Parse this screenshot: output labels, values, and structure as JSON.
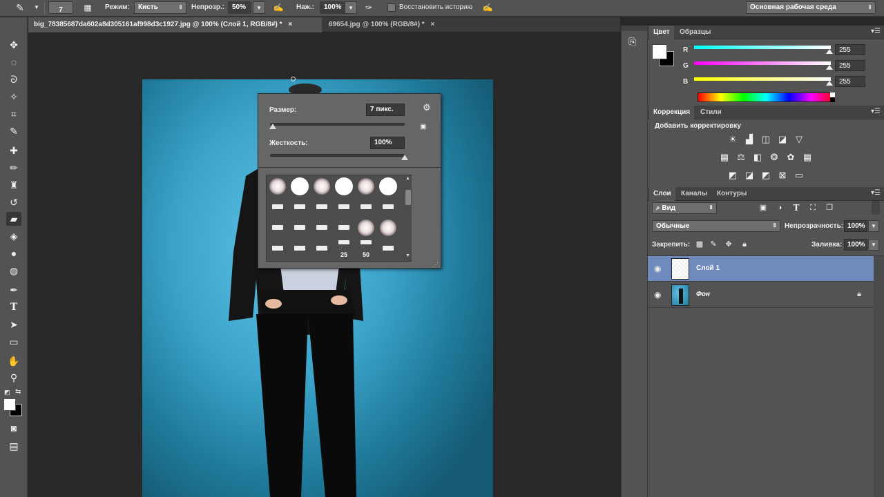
{
  "options_bar": {
    "brush_size": "7",
    "mode_label": "Режим:",
    "mode_value": "Кисть",
    "opacity_label": "Непрозр.:",
    "opacity_value": "50%",
    "pressure_label": "Наж.:",
    "pressure_value": "100%",
    "restore_history_label": "Восстановить историю",
    "workspace_value": "Основная рабочая среда"
  },
  "tabs": [
    {
      "label": "big_78385687da602a8d305161af998d3c1927.jpg @ 100% (Слой 1, RGB/8#) *",
      "close": "×"
    },
    {
      "label": "69654.jpg @ 100% (RGB/8#) *",
      "close": "×"
    }
  ],
  "brush_popup": {
    "size_label": "Размер:",
    "size_value": "7 пикс.",
    "size_fraction": 0.02,
    "hardness_label": "Жесткость:",
    "hardness_value": "100%",
    "hardness_fraction": 1.0,
    "brush_numbers": [
      "25",
      "50"
    ]
  },
  "color_panel": {
    "tabs": [
      "Цвет",
      "Образцы"
    ],
    "channels": [
      {
        "label": "R",
        "value": "255"
      },
      {
        "label": "G",
        "value": "255"
      },
      {
        "label": "B",
        "value": "255"
      }
    ]
  },
  "adjustments_panel": {
    "tabs": [
      "Коррекция",
      "Стили"
    ],
    "title": "Добавить корректировку"
  },
  "layers_panel": {
    "tabs": [
      "Слои",
      "Каналы",
      "Контуры"
    ],
    "filter_label": "Вид",
    "blend_mode": "Обычные",
    "opacity_label": "Непрозрачность:",
    "opacity_value": "100%",
    "lock_label": "Закрепить:",
    "fill_label": "Заливка:",
    "fill_value": "100%",
    "layers": [
      {
        "name": "Слой 1",
        "selected": true
      },
      {
        "name": "Фон",
        "selected": false,
        "locked": true
      }
    ]
  },
  "colors": {
    "accent_selected_layer": "#6f8bbd",
    "canvas_bg": "#3aa2c8"
  }
}
